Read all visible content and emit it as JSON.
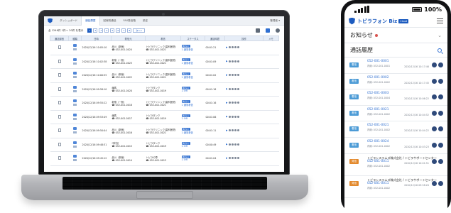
{
  "laptop": {
    "top_tabs": [
      "ダッシュボード",
      "通話履歴",
      "回線別通話",
      "FAX受信箱",
      "設定"
    ],
    "active_tab_index": 1,
    "top_user": "管理者 ▾",
    "toolbar": {
      "count_label": "全 1246件 1件〜 20件 を表示",
      "pages": [
        "1",
        "2",
        "3",
        "4",
        "5",
        "6",
        "7",
        "8"
      ],
      "next_label": "次へ ▸"
    },
    "columns": [
      "通話録音",
      "種類",
      "日時",
      "発信元",
      "着信",
      "ステータス",
      "通話時間",
      "操作",
      "メモ"
    ],
    "rows": [
      {
        "date": "2020/12/16 10:05:10",
        "from_name": "品川（新宿）",
        "from_num": "052-001-0024",
        "to_name": "トビラクリニック(歯科医院)",
        "to_num": "052-001-0021",
        "status": "通話完了",
        "status_sub": "1 通常着信",
        "duration": "00:01:21"
      },
      {
        "date": "2020/12/16 10:02:38",
        "from_name": "新宿（一般）",
        "from_num": "052-001-0023",
        "to_name": "トビラクリニック(歯科医院)",
        "to_num": "052-001-0021",
        "status": "通話完了",
        "status_sub": "1 通常着信",
        "duration": "00:01:09"
      },
      {
        "date": "2020/12/16 10:00:55",
        "from_name": "品川（新宿）",
        "from_num": "052-001-0022",
        "to_name": "トビラクリニック(歯科医院)",
        "to_num": "052-001-0021",
        "status": "通話完了",
        "status_sub": "1 通常着信",
        "duration": "00:01:02"
      },
      {
        "date": "2020/12/16 09:58:10",
        "from_name": "練馬",
        "from_num": "052-001-0020",
        "to_name": "トビラタンク",
        "to_num": "052-001-0019",
        "status": "通話完了",
        "status_sub": "1 IVR",
        "duration": "00:01:18"
      },
      {
        "date": "2020/12/16 09:55:22",
        "from_name": "新宿（一般）",
        "from_num": "052-001-0018",
        "to_name": "トビラクリニック(歯科医院)",
        "to_num": "052-001-0021",
        "status": "通話完了",
        "status_sub": "1 通常着信",
        "duration": "00:01:16"
      },
      {
        "date": "2020/12/16 09:53:49",
        "from_name": "練馬",
        "from_num": "052-001-0017",
        "to_name": "トビラタンク",
        "to_num": "052-001-0019",
        "status": "通話完了",
        "status_sub": "1 IVR",
        "duration": "00:01:06"
      },
      {
        "date": "2020/12/16 09:50:04",
        "from_name": "品川（新宿）",
        "from_num": "052-001-0016",
        "to_name": "トビラクリニック(歯科医院)",
        "to_num": "052-001-0021",
        "status": "通話完了",
        "status_sub": "1 通常着信",
        "duration": "00:01:11"
      },
      {
        "date": "2020/12/16 09:48:31",
        "from_name": "中村区",
        "from_num": "052-001-0015",
        "to_name": "トビラタンク",
        "to_num": "052-001-0019",
        "status": "通話完了",
        "status_sub": "1 IVR",
        "duration": "00:00:49"
      },
      {
        "date": "2020/12/16 09:45:12",
        "from_name": "品川（新宿）",
        "from_num": "052-001-0014",
        "to_name": "トビラの草",
        "to_num": "052-001-0013",
        "status": "通話完了",
        "status_sub": "1 IVR",
        "duration": "00:01:04"
      }
    ]
  },
  "phone": {
    "status": {
      "time": "",
      "battery": "100%"
    },
    "brand": "トビラフォン Biz",
    "brand_tag": "Cloud",
    "notice_label": "お知らせ",
    "history_label": "通話履歴",
    "items": [
      {
        "badge": "着信",
        "number": "052-001-0001",
        "sub": "内線: 052-001-0001",
        "time": "2020/12/16 10:17:46"
      },
      {
        "badge": "着信",
        "number": "052-001-0002",
        "sub": "内線: 052-001-0002",
        "time": "2020/12/16 10:17:45"
      },
      {
        "badge": "着信",
        "number": "052-001-0003",
        "sub": "内線: 052-001-0004",
        "time": "2020/12/16 10:06:22"
      },
      {
        "badge": "着信",
        "number": "052-001-0021",
        "sub": "内線: 052-001-0002",
        "time": "2020/12/16 10:04:52"
      },
      {
        "badge": "着信",
        "number": "052-001-0021",
        "sub": "内線: 052-001-0002",
        "time": "2020/12/16 10:04:22"
      },
      {
        "badge": "着信",
        "number": "052-001-0024",
        "sub": "内線: 052-001-0002",
        "time": "2020/12/16 10:03:23"
      },
      {
        "badge": "発信",
        "name": "トビラシステムズ株式会社 / トビラサポートセンター",
        "number": "052-001-0011",
        "sub": "内線: 052-001-0002",
        "time": "2020/12/16 10:01:51",
        "tall": true
      },
      {
        "badge": "発信",
        "name": "トビラシステムズ株式会社 / トビラサポートセンター",
        "number": "052-001-0011",
        "sub": "内線: 052-001-0002",
        "time": "2020/12/16 09:58:20",
        "tall": true
      }
    ]
  },
  "colors": {
    "brand": "#1c5bbf",
    "incoming_badge": "#4c9bd6",
    "outgoing_badge": "#e38a2e",
    "notice_dot": "#d9534f"
  }
}
